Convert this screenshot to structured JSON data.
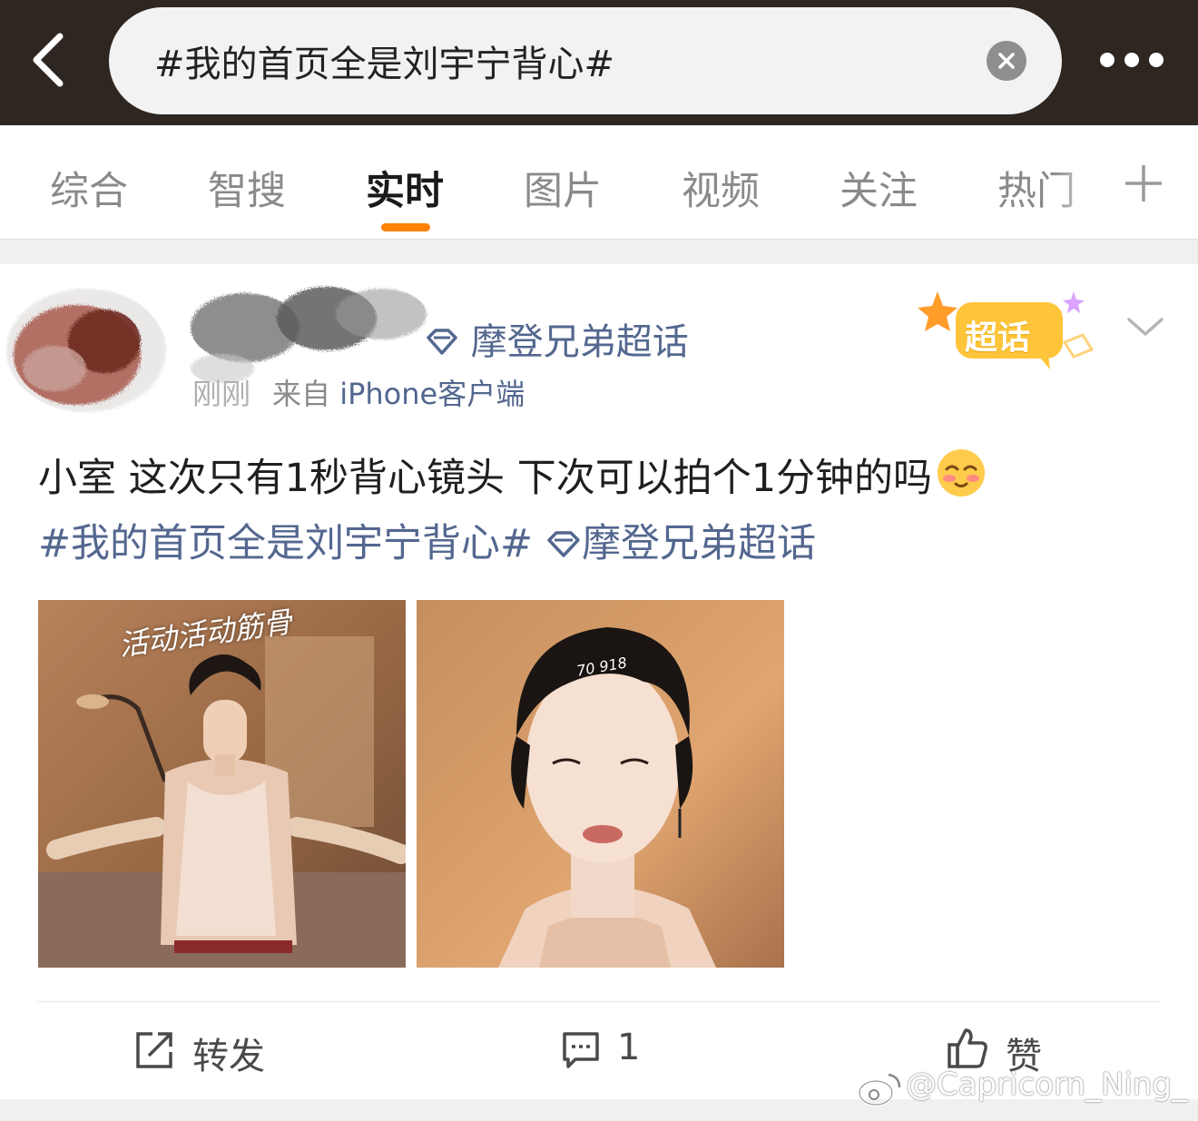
{
  "search": {
    "query": "#我的首页全是刘宇宁背心#",
    "clear_icon": "close-icon",
    "more_icon": "more-dots-icon"
  },
  "tabs": [
    {
      "label": "综合",
      "active": false
    },
    {
      "label": "智搜",
      "active": false
    },
    {
      "label": "实时",
      "active": true
    },
    {
      "label": "图片",
      "active": false
    },
    {
      "label": "视频",
      "active": false
    },
    {
      "label": "关注",
      "active": false
    },
    {
      "label": "热门",
      "active": false
    }
  ],
  "tab_add_icon": "plus-icon",
  "post": {
    "channel": "摩登兄弟超话",
    "time": "刚刚",
    "source_prefix": "来自",
    "source": "iPhone客户端",
    "badge_label": "超话",
    "text": "小室 这次只有1秒背心镜头 下次可以拍个1分钟的吗",
    "topic": "#我的首页全是刘宇宁背心#",
    "channel_link": "摩登兄弟超话",
    "image1_overlay": "活动活动筋骨",
    "image2_overlay": "70 918",
    "actions": {
      "repost_label": "转发",
      "comment_count": "1",
      "like_label": "赞"
    }
  },
  "watermark": "@Capricorn_Ning_",
  "colors": {
    "accent": "#ff8200",
    "link": "#53678f",
    "topbar": "#2e2620"
  }
}
